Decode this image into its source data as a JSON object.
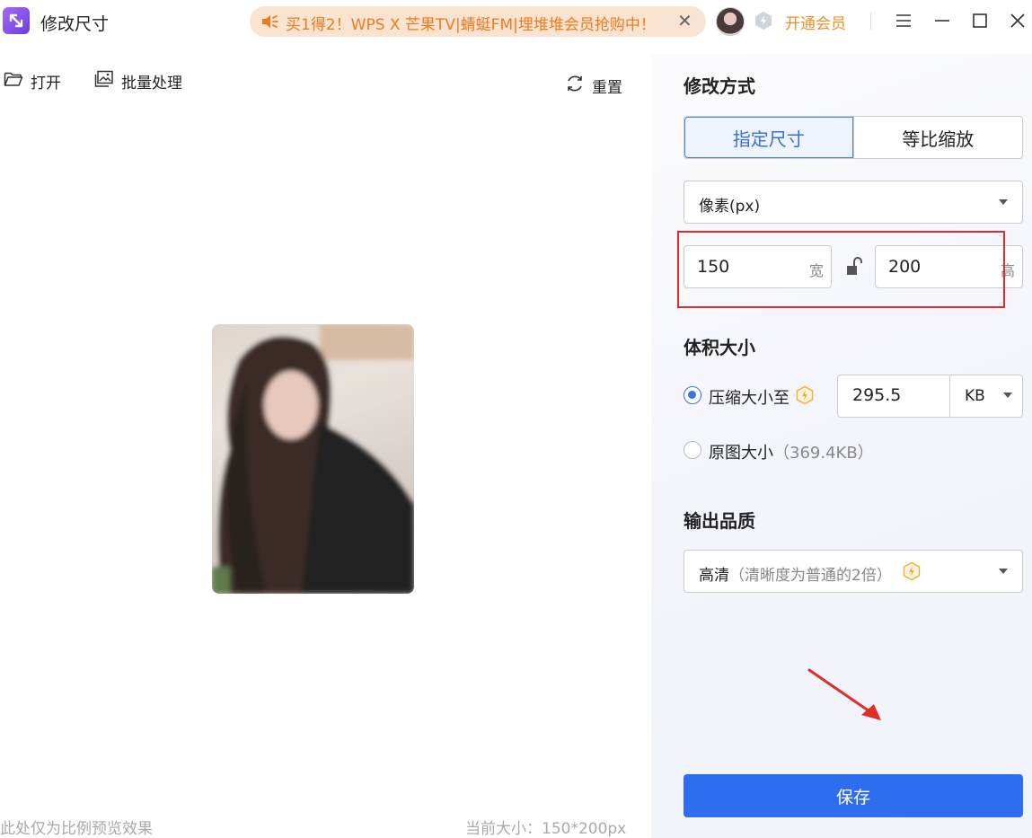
{
  "titlebar": {
    "app_title": "修改尺寸",
    "promo_text": "买1得2！WPS X 芒果TV|蜻蜓FM|埋堆堆会员抢购中！",
    "promo_close": "✕",
    "vip_label": "开通会员"
  },
  "toolbar": {
    "open_label": "打开",
    "batch_label": "批量处理",
    "reset_label": "重置"
  },
  "preview": {
    "footer_note": "此处仅为比例预览效果",
    "current_size": "当前大小：150*200px"
  },
  "settings": {
    "mode_title": "修改方式",
    "mode_tabs": [
      "指定尺寸",
      "等比缩放"
    ],
    "unit_select": "像素(px)",
    "width_value": "150",
    "width_unit": "宽",
    "height_value": "200",
    "height_unit": "高",
    "size_title": "体积大小",
    "compress_label": "压缩大小至",
    "compress_value": "295.5",
    "compress_unit": "KB",
    "original_label": "原图大小",
    "original_size": "（369.4KB）",
    "quality_title": "输出品质",
    "quality_value": "高清",
    "quality_note": "（清晰度为普通的2倍）",
    "save_label": "保存"
  },
  "colors": {
    "accent": "#2f6df0",
    "promo_text": "#f07b1b",
    "vip": "#f09325",
    "annotation_red": "#e22b2b"
  }
}
